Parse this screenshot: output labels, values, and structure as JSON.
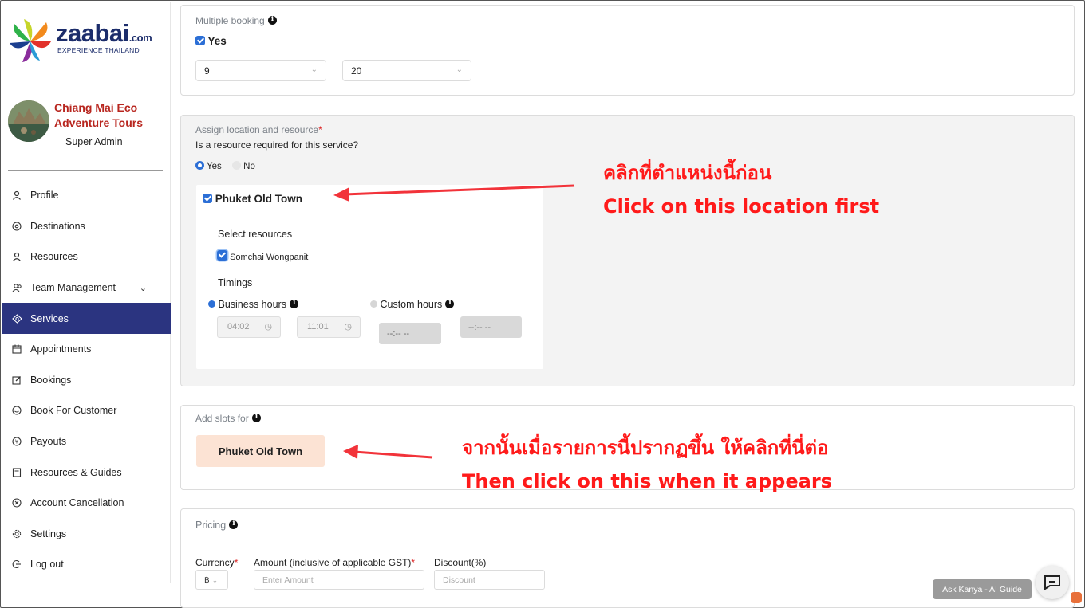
{
  "brand": {
    "logo_text": "zaabai",
    "logo_suffix": ".com",
    "logo_tagline": "EXPERIENCE THAILAND"
  },
  "sidebar": {
    "org_name": "Chiang Mai Eco Adventure Tours",
    "role": "Super Admin",
    "items": [
      {
        "label": "Profile",
        "icon": "user-icon"
      },
      {
        "label": "Destinations",
        "icon": "location-pin-icon"
      },
      {
        "label": "Resources",
        "icon": "user-icon"
      },
      {
        "label": "Team Management",
        "icon": "team-icon",
        "has_chevron": true
      },
      {
        "label": "Services",
        "icon": "services-icon",
        "active": true
      },
      {
        "label": "Appointments",
        "icon": "calendar-icon"
      },
      {
        "label": "Bookings",
        "icon": "edit-icon"
      },
      {
        "label": "Book For Customer",
        "icon": "clock-icon"
      },
      {
        "label": "Payouts",
        "icon": "money-icon"
      },
      {
        "label": "Resources & Guides",
        "icon": "document-icon"
      },
      {
        "label": "Account Cancellation",
        "icon": "cancel-icon"
      },
      {
        "label": "Settings",
        "icon": "gear-icon"
      },
      {
        "label": "Log out",
        "icon": "logout-icon"
      }
    ]
  },
  "multiple_booking": {
    "label": "Multiple booking",
    "checkbox_label": "Yes",
    "checked": true,
    "select1_value": "9",
    "select2_value": "20"
  },
  "assign": {
    "label": "Assign location and resource",
    "required_mark": "*",
    "question": "Is a resource required for this service?",
    "radio_yes": "Yes",
    "radio_no": "No",
    "selected": "Yes",
    "location_name": "Phuket Old Town",
    "select_resources_label": "Select resources",
    "resource_name": "Somchai Wongpanit",
    "timings_label": "Timings",
    "business_hours_label": "Business hours",
    "custom_hours_label": "Custom hours",
    "start_time": "04:02",
    "end_time": "11:01",
    "custom_start": "--:-- --",
    "custom_end": "--:-- --"
  },
  "slots": {
    "label": "Add slots for",
    "chip": "Phuket Old Town"
  },
  "pricing": {
    "label": "Pricing",
    "currency_label": "Currency",
    "currency_value": "฿",
    "amount_label": "Amount (inclusive of applicable GST)",
    "amount_placeholder": "Enter Amount",
    "discount_label": "Discount(%)",
    "discount_placeholder": "Discount"
  },
  "annotations": {
    "top_thai": "คลิกที่ตำแหน่งนี้ก่อน",
    "top_en": "Click on this location first",
    "bottom_thai": "จากนั้นเมื่อรายการนี้ปรากฏขึ้น ให้คลิกที่นี่ต่อ",
    "bottom_en": "Then click on this when it appears",
    "color": "#ff1a1a"
  },
  "assistant": {
    "ask_label": "Ask Kanya - AI Guide"
  },
  "colors": {
    "sidebar_active": "#2b3480",
    "org_name": "#b8261f",
    "checkbox": "#2c6fd6",
    "slot_chip": "#fce3d4"
  }
}
